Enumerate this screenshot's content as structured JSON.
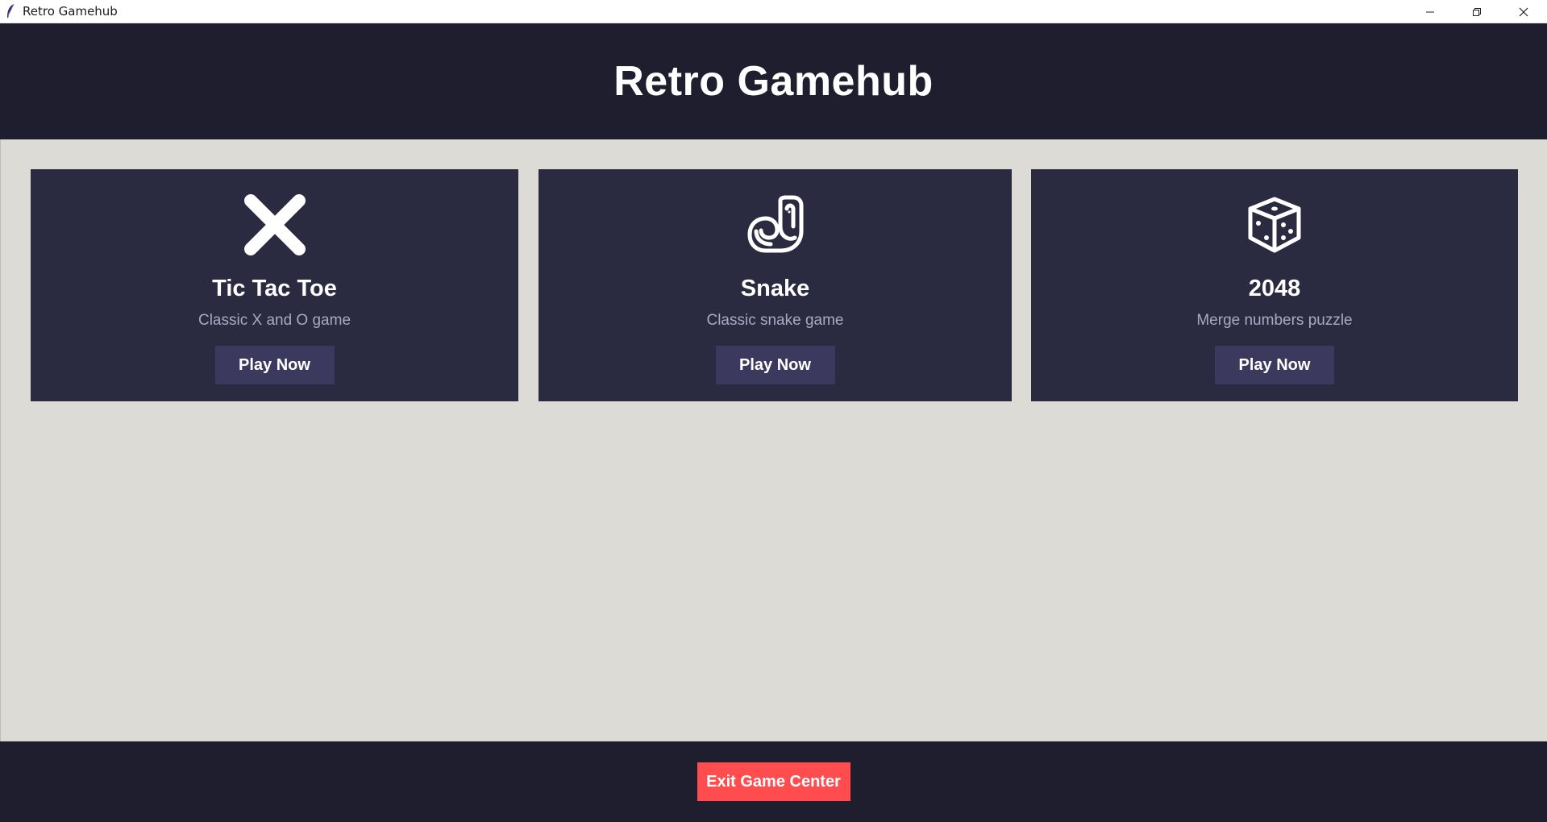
{
  "window": {
    "title": "Retro Gamehub",
    "controls": [
      "minimize-icon",
      "restore-icon",
      "close-icon"
    ]
  },
  "header": {
    "title": "Retro Gamehub"
  },
  "games": [
    {
      "name": "Tic Tac Toe",
      "description": "Classic X and O game",
      "button_label": "Play Now",
      "icon": "x-mark-icon"
    },
    {
      "name": "Snake",
      "description": "Classic snake game",
      "button_label": "Play Now",
      "icon": "snake-icon"
    },
    {
      "name": "2048",
      "description": "Merge numbers puzzle",
      "button_label": "Play Now",
      "icon": "dice-icon"
    }
  ],
  "footer": {
    "exit_label": "Exit Game Center"
  },
  "colors": {
    "header_bg": "#1e1e2f",
    "card_bg": "#2a2a40",
    "button_bg": "#3b3a5e",
    "exit_bg": "#ff4d4f",
    "content_bg": "#dcdbd5",
    "desc_text": "#a9a9c6"
  }
}
